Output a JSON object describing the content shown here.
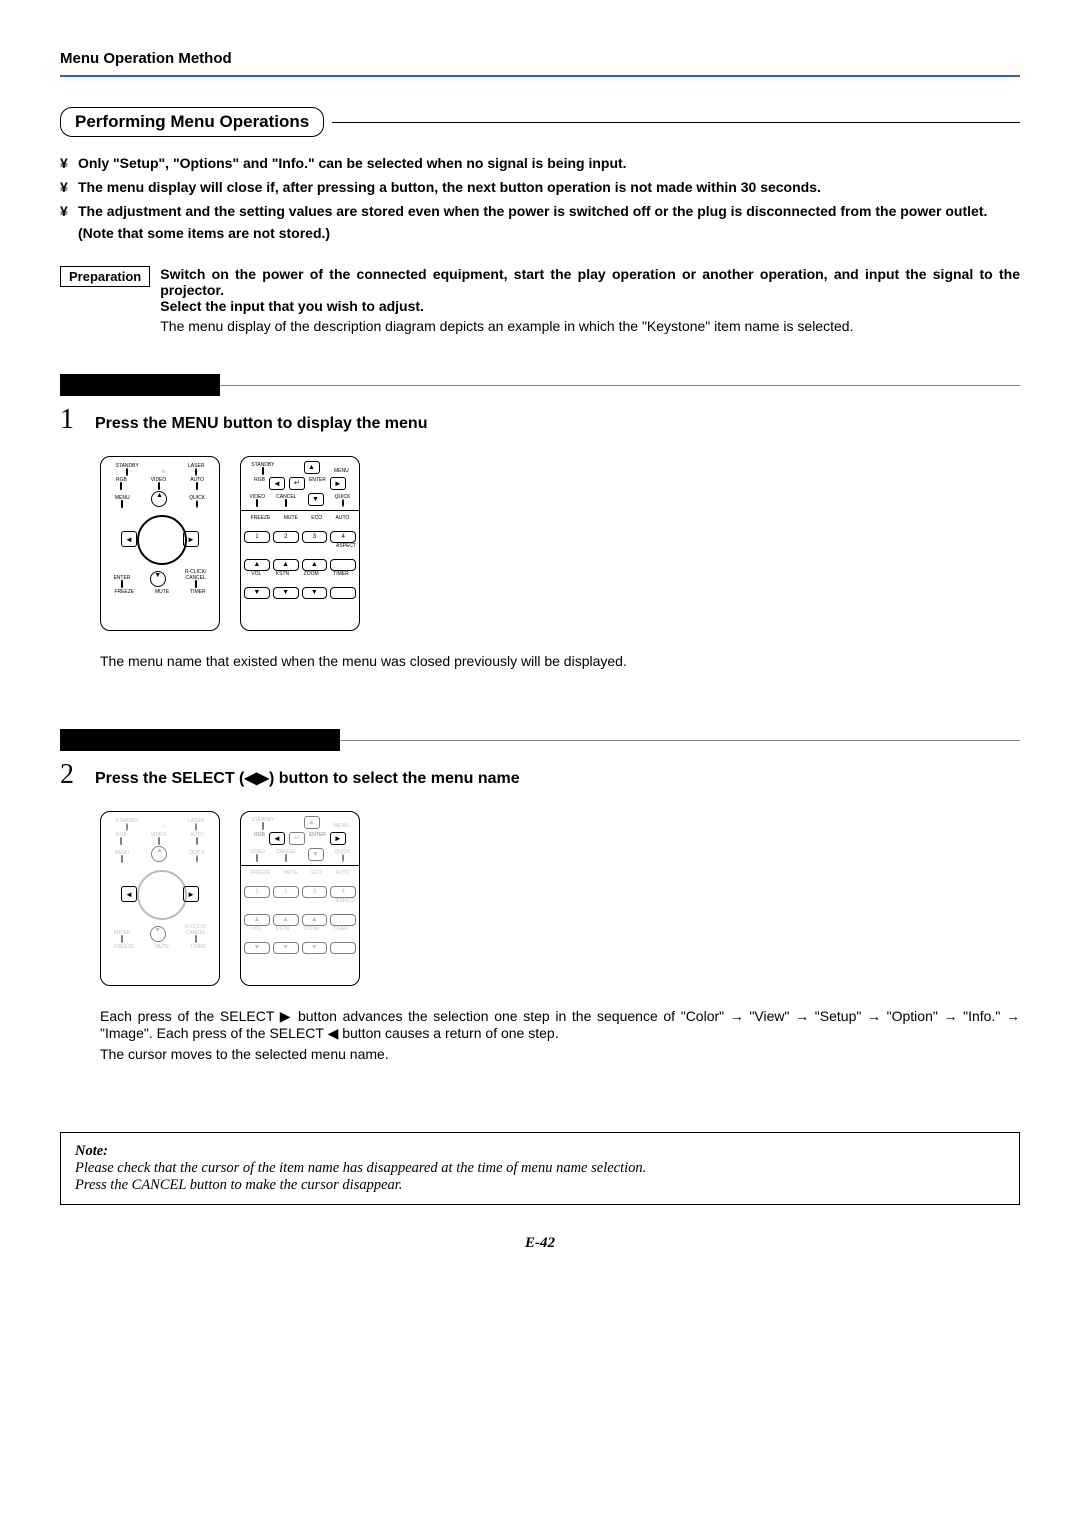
{
  "header": "Menu Operation Method",
  "section_title": "Performing Menu Operations",
  "bullets": [
    "Only \"Setup\", \"Options\" and \"Info.\" can be selected when no signal is being input.",
    "The menu display will close if, after pressing a button, the next button operation is not made within 30 seconds.",
    "The adjustment and the setting values are stored even when the power is switched off or the plug is disconnected from the power outlet."
  ],
  "bullet3_sub": "(Note that some items are not stored.)",
  "prep": {
    "label": "Preparation",
    "bold1": "Switch on the power of the connected equipment, start the play operation or another operation, and input the signal to the projector.",
    "bold2": "Select the input that you wish to adjust.",
    "regular": "The menu display of the description diagram depicts an example in which the \"Keystone\" item name is selected."
  },
  "step1": {
    "num": "1",
    "title": "Press the MENU button to display the menu",
    "body": "The menu name that existed when the menu was closed previously will be displayed."
  },
  "step2": {
    "num": "2",
    "title": "Press the SELECT (◀▶) button to select the menu name",
    "body1": "Each press of the SELECT ▶ button advances the selection one step in the sequence of \"Color\" → \"View\" → \"Setup\" → \"Option\" → \"Info.\" → \"Image\". Each press of the SELECT ◀ button causes a return of one step.",
    "body2": "The cursor moves to the selected menu name."
  },
  "remote_labels": {
    "standby": "STANDBY",
    "laser": "LASER",
    "rgb": "RGB",
    "video": "VIDEO",
    "auto": "AUTO",
    "menu": "MENU",
    "quick": "QUICK",
    "enter": "ENTER",
    "rclick": "R-CLICK/",
    "cancel": "CANCEL",
    "freeze": "FREEZE",
    "mute": "MUTE",
    "timer": "TIMER",
    "eco": "ECO",
    "aspect": "ASPECT",
    "vol": "VOL",
    "kstn": "KSTN",
    "zoom": "ZOOM"
  },
  "note": {
    "heading": "Note:",
    "line1": "Please check that the cursor of the item name has disappeared at the time of menu name selection.",
    "line2": "Press the CANCEL button to make the cursor disappear."
  },
  "page_num": "E-42"
}
